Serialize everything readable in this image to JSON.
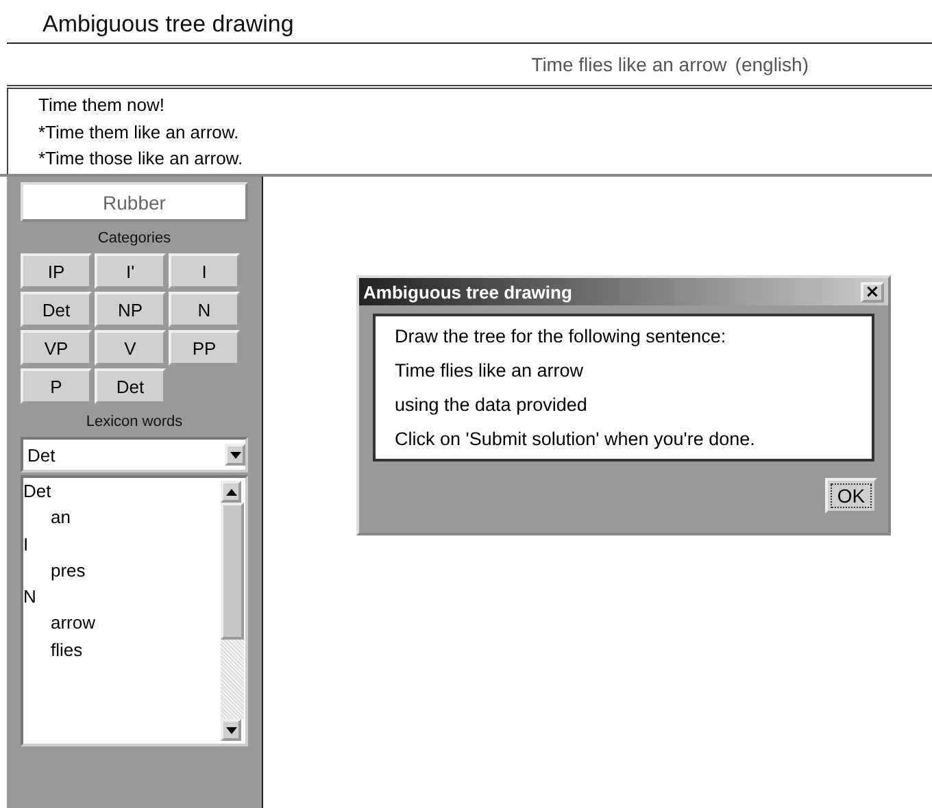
{
  "page_title": "Ambiguous tree drawing",
  "sentence_header": {
    "sentence": "Time flies like an arrow",
    "language": "(english)"
  },
  "sentences": [
    "Time them now!",
    "*Time them like an arrow.",
    "*Time those like an arrow."
  ],
  "palette": {
    "rubber": "Rubber",
    "categories_label": "Categories",
    "categories": [
      "IP",
      "I'",
      "I",
      "Det",
      "NP",
      "N",
      "VP",
      "V",
      "PP",
      "P",
      "Det"
    ],
    "lexicon_label": "Lexicon words",
    "lexicon_dropdown": {
      "value": "Det"
    },
    "lexicon": [
      {
        "label": "Det",
        "children": [
          {
            "label": "an"
          }
        ]
      },
      {
        "label": "I",
        "children": [
          {
            "label": "pres"
          }
        ]
      },
      {
        "label": "N",
        "children": [
          {
            "label": "arrow"
          },
          {
            "label": "flies"
          }
        ]
      }
    ]
  },
  "dialog": {
    "title": "Ambiguous tree drawing",
    "close": "×",
    "lines": [
      "Draw the tree for the following sentence:",
      "Time flies like an arrow",
      "using the data provided",
      "Click on 'Submit solution' when you're done."
    ],
    "button": "OK"
  }
}
